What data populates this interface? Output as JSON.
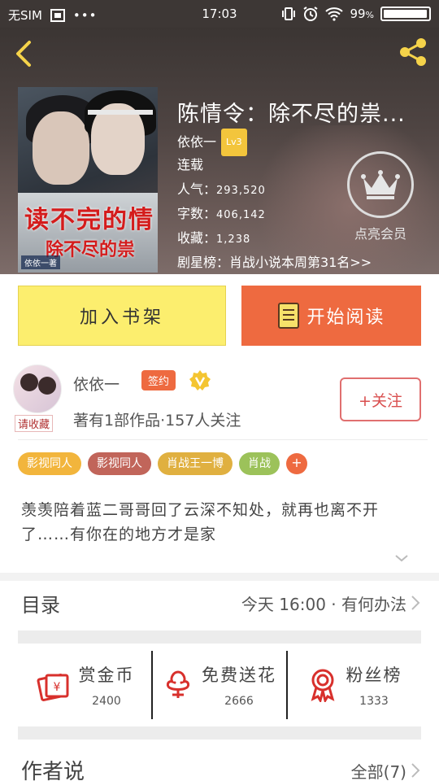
{
  "status_bar": {
    "carrier": "无SIM",
    "time": "17:03",
    "battery": "99",
    "battery_level": 0.99
  },
  "header": {
    "back_icon": "chevron-left-icon",
    "share_icon": "share-icon"
  },
  "book": {
    "title": "陈情令：除不尽的祟...",
    "author": "依依一",
    "level": "Lv3",
    "status": "连载",
    "popularity_label": "人气：",
    "popularity": "293,520",
    "words_label": "字数：",
    "words": "406,142",
    "favorites_label": "收藏：",
    "favorites": "1,238",
    "rank_label": "剧星榜：",
    "rank_text": "肖战小说本周第31名>>",
    "cover_title_1": "读不完的情",
    "cover_title_2": "除不尽的祟",
    "cover_author": "依依一著",
    "vip_label": "点亮会员"
  },
  "actions": {
    "add_shelf": "加入书架",
    "start_read": "开始阅读"
  },
  "author": {
    "name": "依依一",
    "sign_badge": "签约",
    "fav_tag": "请收藏",
    "summary": "著有1部作品·157人关注",
    "follow": "+关注"
  },
  "tags": [
    {
      "label": "影视同人",
      "color": "#f2b53c"
    },
    {
      "label": "影视同人",
      "color": "#c1655a"
    },
    {
      "label": "肖战王一博",
      "color": "#e0b040"
    },
    {
      "label": "肖战",
      "color": "#9cc25a"
    },
    {
      "label": "+",
      "color": "#ee6a40"
    }
  ],
  "intro": "羡羡陪着蓝二哥哥回了云深不知处，就再也离不开了……有你在的地方才是家",
  "toc": {
    "label": "目录",
    "latest": "今天 16:00 · 有何办法"
  },
  "stats": [
    {
      "name": "赏金币",
      "value": "2400",
      "icon": "red-envelope-icon"
    },
    {
      "name": "免费送花",
      "value": "2666",
      "icon": "flower-icon"
    },
    {
      "name": "粉丝榜",
      "value": "1333",
      "icon": "award-ribbon-icon"
    }
  ],
  "author_says": {
    "label": "作者说",
    "all": "全部(7)"
  },
  "colors": {
    "accent_orange": "#ee6a40",
    "button_yellow": "#fcee6e",
    "follow_red": "#d94f4f"
  }
}
